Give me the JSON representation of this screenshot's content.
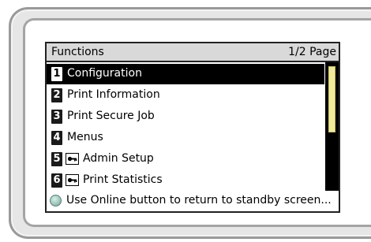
{
  "screen": {
    "title": "Functions",
    "page_indicator": "1/2 Page"
  },
  "menu": {
    "items": [
      {
        "number": "1",
        "label": "Configuration",
        "selected": true,
        "locked": false
      },
      {
        "number": "2",
        "label": "Print Information",
        "selected": false,
        "locked": false
      },
      {
        "number": "3",
        "label": "Print Secure Job",
        "selected": false,
        "locked": false
      },
      {
        "number": "4",
        "label": "Menus",
        "selected": false,
        "locked": false
      },
      {
        "number": "5",
        "label": "Admin Setup",
        "selected": false,
        "locked": true
      },
      {
        "number": "6",
        "label": "Print Statistics",
        "selected": false,
        "locked": true
      }
    ]
  },
  "footer": {
    "icon": "online-led-icon",
    "message": "Use Online button to return to standby screen..."
  },
  "scroll": {
    "position_fraction": 0.0,
    "visible_fraction": 0.55
  },
  "colors": {
    "selected_bg": "#000000",
    "title_bg": "#d9d9d9",
    "scroll_thumb": "#f0ea9a",
    "led": "#9fc7bd"
  }
}
